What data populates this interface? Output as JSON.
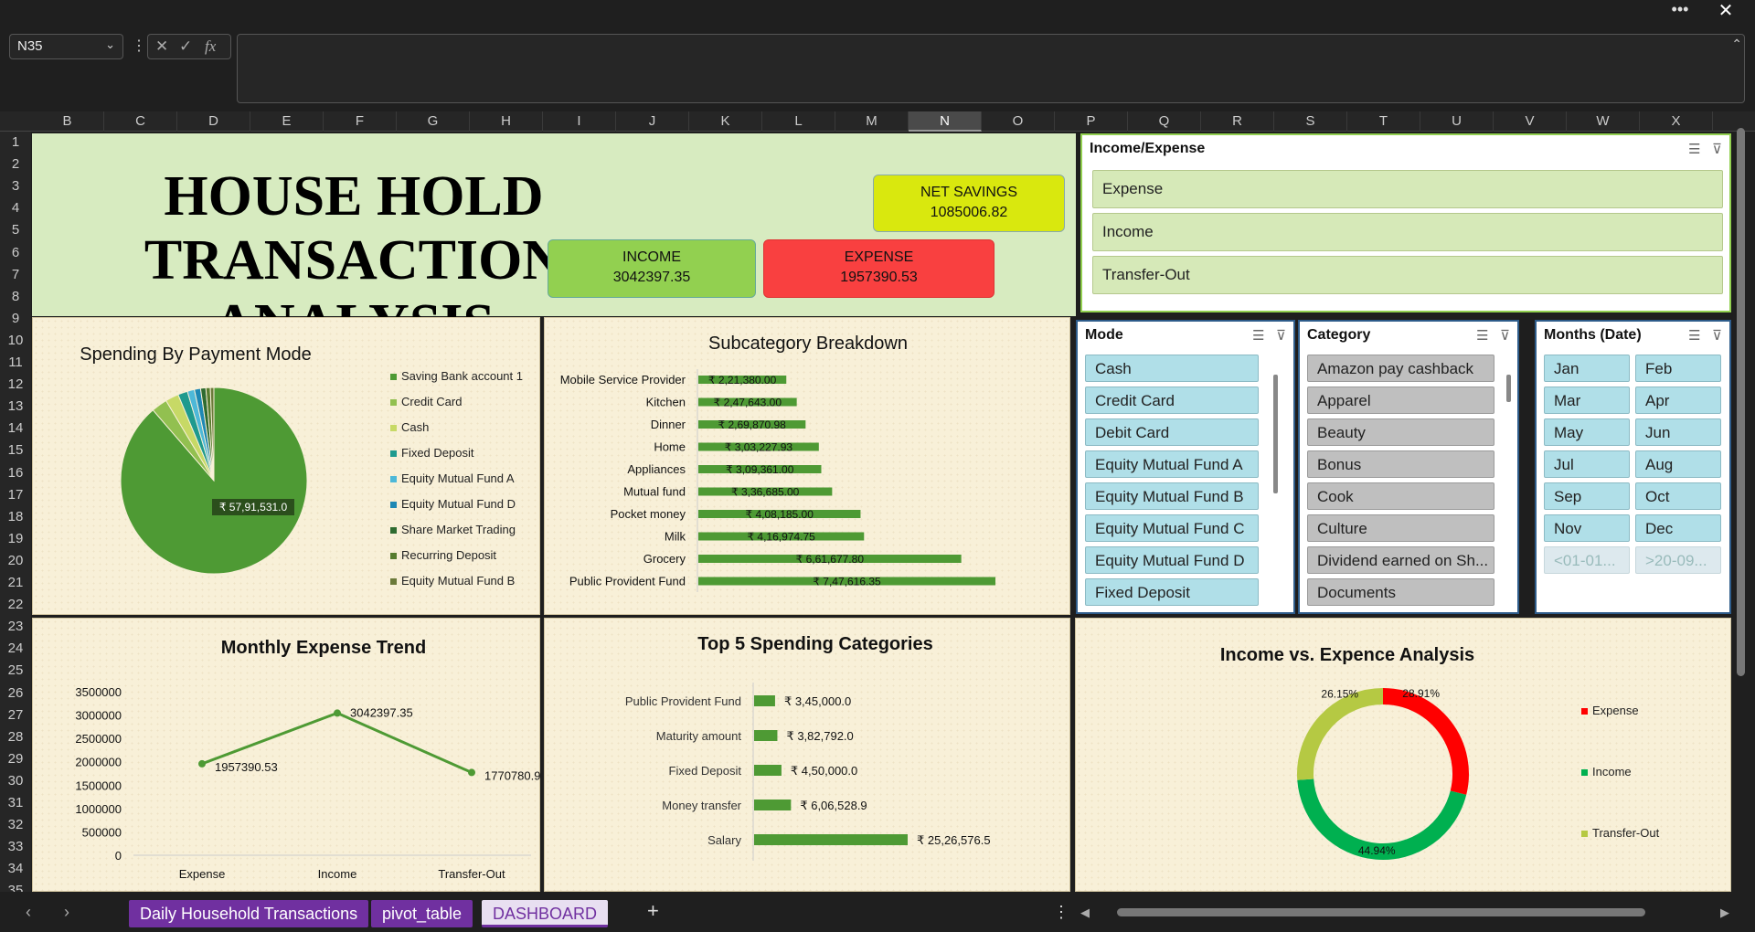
{
  "window": {
    "more_label": "•••",
    "close_label": "✕"
  },
  "formula_bar": {
    "name_box": "N35",
    "fx_label": "fx",
    "formula": ""
  },
  "columns": [
    "B",
    "C",
    "D",
    "E",
    "F",
    "G",
    "H",
    "I",
    "J",
    "K",
    "L",
    "M",
    "N",
    "O",
    "P",
    "Q",
    "R",
    "S",
    "T",
    "U",
    "V",
    "W",
    "X"
  ],
  "selected_column": "N",
  "rows": [
    "1",
    "2",
    "3",
    "4",
    "5",
    "6",
    "7",
    "8",
    "9",
    "10",
    "11",
    "12",
    "13",
    "14",
    "15",
    "16",
    "17",
    "18",
    "19",
    "20",
    "21",
    "22",
    "23",
    "24",
    "25",
    "26",
    "27",
    "28",
    "29",
    "30",
    "31",
    "32",
    "33",
    "34",
    "35"
  ],
  "header": {
    "title_line1": "HOUSE HOLD TRANSACTION",
    "title_line2": "ANALYSIS",
    "net_savings_label": "NET SAVINGS",
    "net_savings_value": "1085006.82",
    "income_label": "INCOME",
    "income_value": "3042397.35",
    "expense_label": "EXPENSE",
    "expense_value": "1957390.53"
  },
  "slicers": {
    "income_expense": {
      "title": "Income/Expense",
      "items": [
        "Expense",
        "Income",
        "Transfer-Out"
      ]
    },
    "mode": {
      "title": "Mode",
      "items": [
        "Cash",
        "Credit Card",
        "Debit Card",
        "Equity Mutual Fund A",
        "Equity Mutual Fund B",
        "Equity Mutual Fund C",
        "Equity Mutual Fund D",
        "Fixed Deposit"
      ]
    },
    "category": {
      "title": "Category",
      "items": [
        "Amazon pay cashback",
        "Apparel",
        "Beauty",
        "Bonus",
        "Cook",
        "Culture",
        "Dividend earned on Sh...",
        "Documents"
      ]
    },
    "months": {
      "title": "Months (Date)",
      "items": [
        "Jan",
        "Feb",
        "Mar",
        "Apr",
        "May",
        "Jun",
        "Jul",
        "Aug",
        "Sep",
        "Oct",
        "Nov",
        "Dec",
        "<01-01...",
        ">20-09..."
      ]
    }
  },
  "colors": {
    "bar_green": "#4e9a34",
    "expense_red": "#ff0000",
    "income_green": "#00b050",
    "transfer_yellowgreen": "#b5c943"
  },
  "chart_data": [
    {
      "type": "pie",
      "title": "Spending By Payment Mode",
      "data_label": "₹ 57,91,531.0",
      "categories": [
        "Saving Bank account 1",
        "Credit Card",
        "Cash",
        "Fixed Deposit",
        "Equity Mutual Fund A",
        "Equity Mutual Fund D",
        "Share Market Trading",
        "Recurring Deposit",
        "Equity Mutual Fund B"
      ],
      "values": [
        5791531,
        180000,
        150000,
        110000,
        80000,
        70000,
        60000,
        50000,
        40000
      ],
      "colors": [
        "#4e9a34",
        "#92c050",
        "#c7d966",
        "#1e9a8e",
        "#4db8d8",
        "#1e88b4",
        "#2e6b30",
        "#567c2e",
        "#6b7a3a"
      ],
      "legend_position": "right"
    },
    {
      "type": "bar",
      "orientation": "horizontal",
      "title": "Subcategory Breakdown",
      "categories": [
        "Mobile Service Provider",
        "Kitchen",
        "Dinner",
        "Home",
        "Appliances",
        "Mutual fund",
        "Pocket money",
        "Milk",
        "Grocery",
        "Public Provident Fund"
      ],
      "values": [
        221380.0,
        247643.0,
        269870.98,
        303227.93,
        309361.0,
        336685.0,
        408185.0,
        416974.75,
        661677.8,
        747616.35
      ],
      "labels": [
        "₹ 2,21,380.00",
        "₹ 2,47,643.00",
        "₹ 2,69,870.98",
        "₹ 3,03,227.93",
        "₹ 3,09,361.00",
        "₹ 3,36,685.00",
        "₹ 4,08,185.00",
        "₹ 4,16,974.75",
        "₹ 6,61,677.80",
        "₹ 7,47,616.35"
      ]
    },
    {
      "type": "line",
      "title": "Monthly Expense Trend",
      "categories": [
        "Expense",
        "Income",
        "Transfer-Out"
      ],
      "values": [
        1957390.53,
        3042397.35,
        1770780.9
      ],
      "labels": [
        "1957390.53",
        "3042397.35",
        "1770780.9"
      ],
      "yticks": [
        "3500000",
        "3000000",
        "2500000",
        "2000000",
        "1500000",
        "1000000",
        "500000",
        "0"
      ],
      "ylim": [
        0,
        3500000
      ]
    },
    {
      "type": "bar",
      "orientation": "horizontal",
      "title": "Top 5 Spending Categories",
      "categories": [
        "Public Provident Fund",
        "Maturity amount",
        "Fixed Deposit",
        "Money transfer",
        "Salary"
      ],
      "values": [
        345000.0,
        382792.0,
        450000.0,
        606528.9,
        2526576.5
      ],
      "labels": [
        "₹ 3,45,000.0",
        "₹ 3,82,792.0",
        "₹ 4,50,000.0",
        "₹ 6,06,528.9",
        "₹ 25,26,576.5"
      ]
    },
    {
      "type": "pie",
      "subtype": "donut",
      "title": "Income vs. Expence Analysis",
      "categories": [
        "Expense",
        "Income",
        "Transfer-Out"
      ],
      "values": [
        28.91,
        44.94,
        26.15
      ],
      "labels": [
        "28.91%",
        "44.94%",
        "26.15%"
      ],
      "colors": [
        "#ff0000",
        "#00b050",
        "#b5c943"
      ],
      "legend_position": "right"
    }
  ],
  "tabs": [
    "Daily Household Transactions",
    "pivot_table",
    "DASHBOARD"
  ],
  "tab_nav": {
    "prev": "‹",
    "next": "›",
    "add": "+",
    "more": "⋮"
  }
}
